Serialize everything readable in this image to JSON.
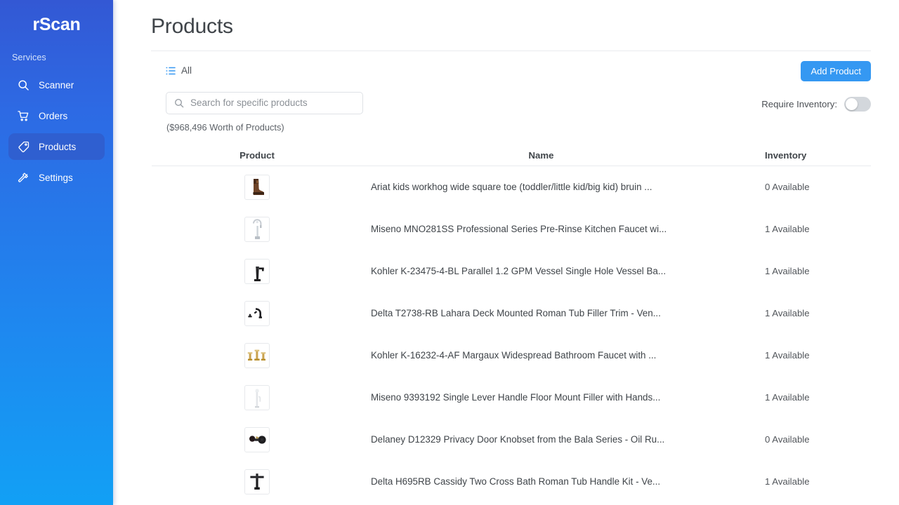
{
  "brand": {
    "name": "rScan"
  },
  "sidebar": {
    "section_label": "Services",
    "items": [
      {
        "label": "Scanner",
        "icon": "search-icon",
        "active": false
      },
      {
        "label": "Orders",
        "icon": "cart-icon",
        "active": false
      },
      {
        "label": "Products",
        "icon": "tag-icon",
        "active": true
      },
      {
        "label": "Settings",
        "icon": "hammer-icon",
        "active": false
      }
    ]
  },
  "header": {
    "title": "Products"
  },
  "toolbar": {
    "tab_label": "All",
    "tab_icon": "list-icon",
    "add_button_label": "Add Product"
  },
  "filters": {
    "search": {
      "value": "",
      "placeholder": "Search for specific products",
      "icon": "search-icon"
    },
    "worth_text": "($968,496 Worth of Products)",
    "require_inventory_label": "Require Inventory:",
    "require_inventory_on": false
  },
  "table": {
    "columns": [
      "Product",
      "Name",
      "Inventory"
    ],
    "rows": [
      {
        "thumb": "boot-thumbnail",
        "name": "Ariat kids workhog wide square toe (toddler/little kid/big kid) bruin ...",
        "inventory": "0 Available"
      },
      {
        "thumb": "chrome-faucet-thumbnail",
        "name": "Miseno MNO281SS Professional Series Pre-Rinse Kitchen Faucet wi...",
        "inventory": "1 Available"
      },
      {
        "thumb": "black-faucet-thumbnail",
        "name": "Kohler K-23475-4-BL Parallel 1.2 GPM Vessel Single Hole Vessel Ba...",
        "inventory": "1 Available"
      },
      {
        "thumb": "tub-filler-thumbnail",
        "name": "Delta T2738-RB Lahara Deck Mounted Roman Tub Filler Trim - Ven...",
        "inventory": "1 Available"
      },
      {
        "thumb": "brass-faucet-thumbnail",
        "name": "Kohler K-16232-4-AF Margaux Widespread Bathroom Faucet with ...",
        "inventory": "1 Available"
      },
      {
        "thumb": "floor-filler-thumbnail",
        "name": "Miseno 9393192 Single Lever Handle Floor Mount Filler with Hands...",
        "inventory": "1 Available"
      },
      {
        "thumb": "doorknob-thumbnail",
        "name": "Delaney D12329 Privacy Door Knobset from the Bala Series - Oil Ru...",
        "inventory": "0 Available"
      },
      {
        "thumb": "cross-handle-thumbnail",
        "name": "Delta H695RB Cassidy Two Cross Bath Roman Tub Handle Kit - Ve...",
        "inventory": "1 Available"
      }
    ]
  },
  "colors": {
    "accent": "#3598f2",
    "sidebar_top": "#3358d4",
    "sidebar_bottom": "#12a0f5",
    "active_item": "#2f5fd0"
  }
}
